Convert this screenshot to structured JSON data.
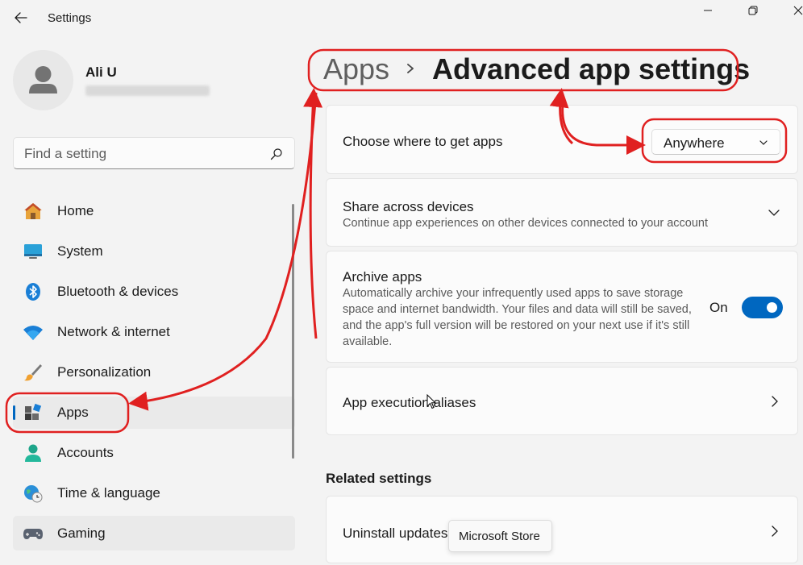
{
  "window": {
    "title": "Settings",
    "controls": {
      "minimize": "minimize-icon",
      "maximize": "restore-icon",
      "close": "close-icon"
    }
  },
  "profile": {
    "name": "Ali U"
  },
  "search": {
    "placeholder": "Find a setting",
    "icon": "search-icon"
  },
  "nav": {
    "items": [
      {
        "label": "Home",
        "icon": "home-icon"
      },
      {
        "label": "System",
        "icon": "system-icon"
      },
      {
        "label": "Bluetooth & devices",
        "icon": "bluetooth-icon"
      },
      {
        "label": "Network & internet",
        "icon": "wifi-icon"
      },
      {
        "label": "Personalization",
        "icon": "brush-icon"
      },
      {
        "label": "Apps",
        "icon": "apps-icon",
        "selected": true
      },
      {
        "label": "Accounts",
        "icon": "accounts-icon"
      },
      {
        "label": "Time & language",
        "icon": "clock-globe-icon"
      },
      {
        "label": "Gaming",
        "icon": "gamepad-icon"
      }
    ]
  },
  "header": {
    "breadcrumb_parent": "Apps",
    "title": "Advanced app settings"
  },
  "main": {
    "choose_where": {
      "title": "Choose where to get apps",
      "selected": "Anywhere"
    },
    "share_across": {
      "title": "Share across devices",
      "description": "Continue app experiences on other devices connected to your account"
    },
    "archive_apps": {
      "title": "Archive apps",
      "description": "Automatically archive your infrequently used apps to save storage space and internet bandwidth. Your files and data will still be saved, and the app's full version will be restored on your next use if it's still available.",
      "toggle_label": "On",
      "toggle_on": true
    },
    "execution_aliases": {
      "title": "App execution aliases"
    },
    "related_heading": "Related settings",
    "uninstall_updates": {
      "title": "Uninstall updates"
    }
  },
  "tooltip": {
    "text": "Microsoft Store"
  },
  "colors": {
    "accent": "#0067c0",
    "annotation": "#e02020",
    "background": "#f3f3f3",
    "card": "#fbfbfb"
  }
}
